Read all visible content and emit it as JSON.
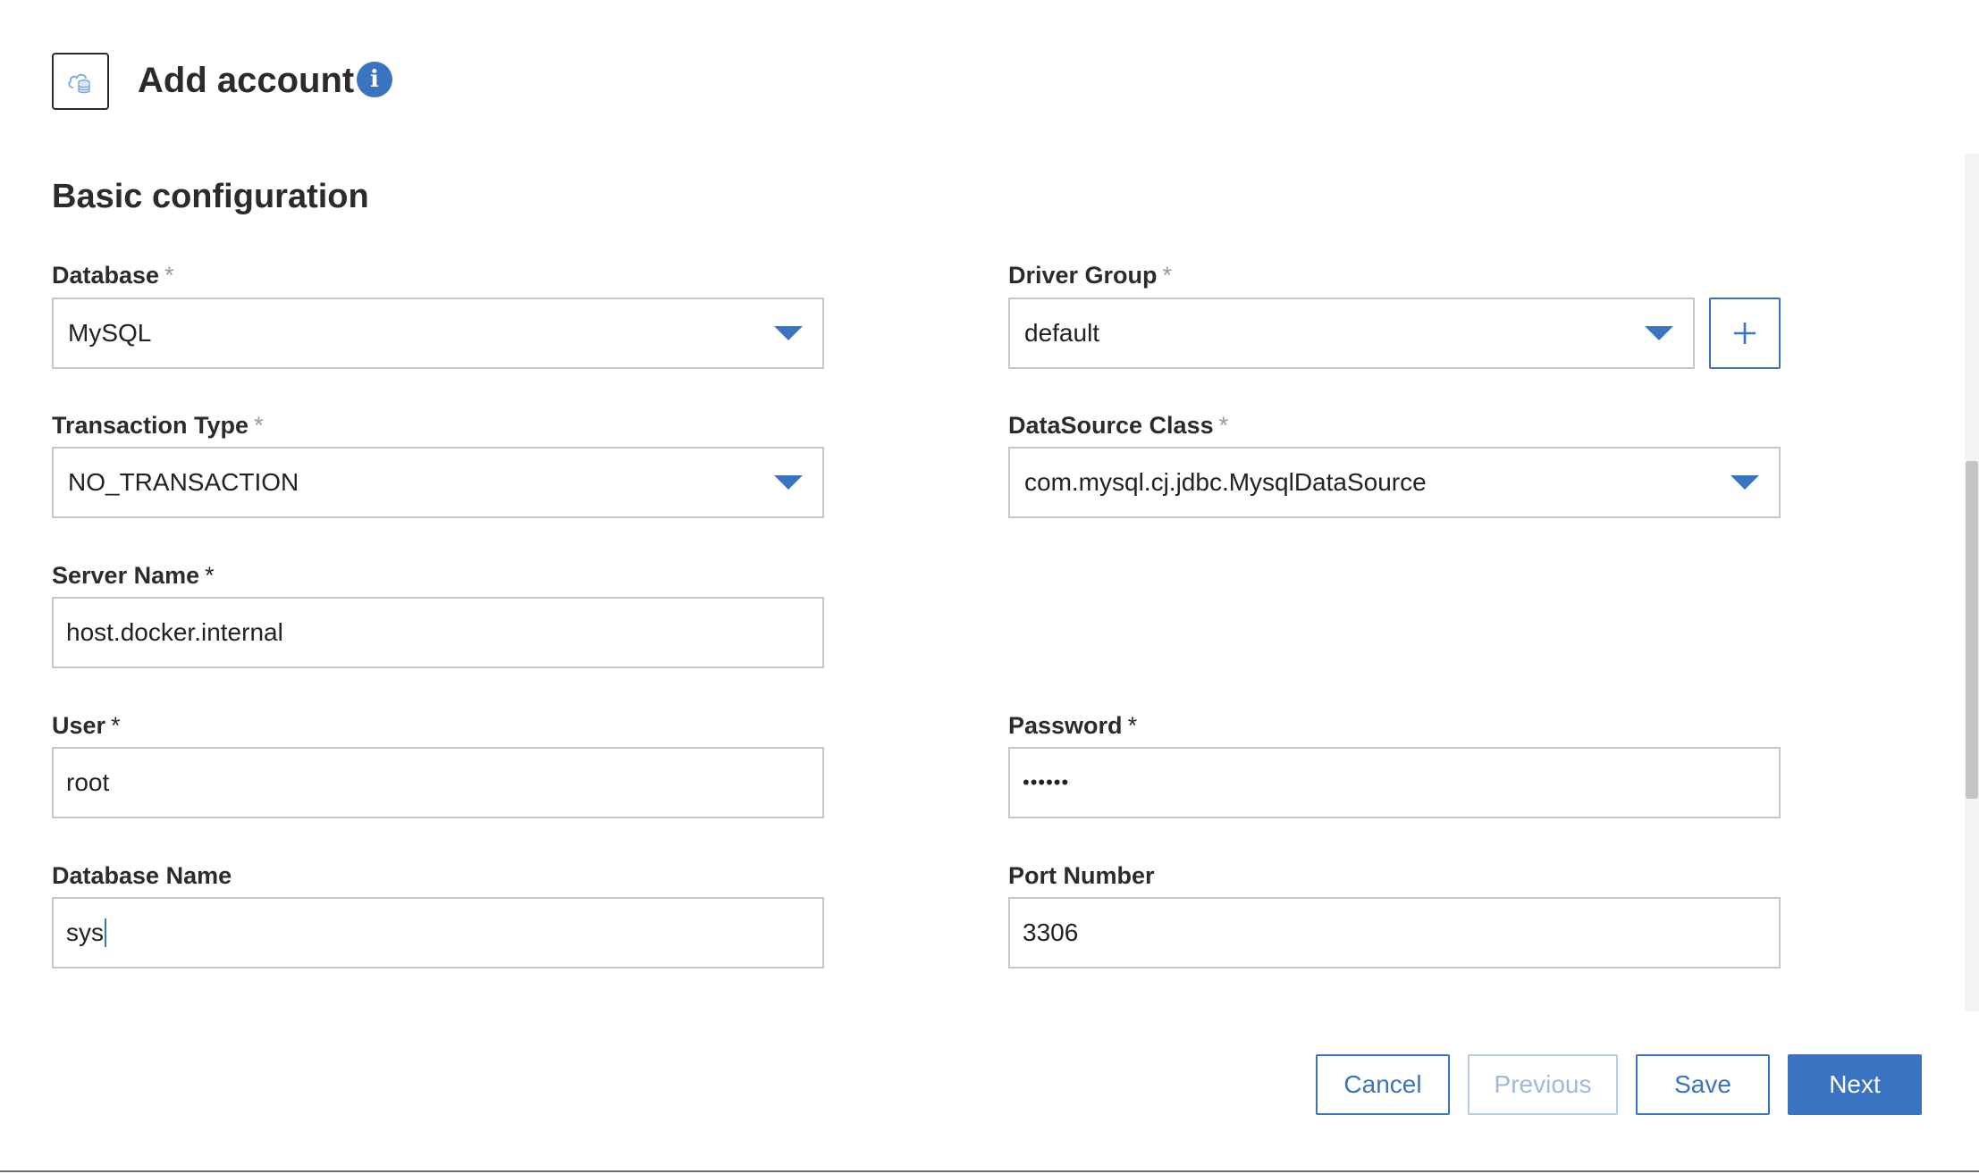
{
  "header": {
    "title": "Add account",
    "icon": "cloud-database-icon",
    "info_icon": "info-icon"
  },
  "section": {
    "title": "Basic configuration"
  },
  "fields": {
    "database": {
      "label": "Database",
      "required": "*",
      "value": "MySQL"
    },
    "driver_group": {
      "label": "Driver Group",
      "required": "*",
      "value": "default",
      "add_icon": "plus-icon"
    },
    "transaction_type": {
      "label": "Transaction Type",
      "required": "*",
      "value": "NO_TRANSACTION"
    },
    "datasource_class": {
      "label": "DataSource Class",
      "required": "*",
      "value": "com.mysql.cj.jdbc.MysqlDataSource"
    },
    "server_name": {
      "label": "Server Name",
      "required": "*",
      "value": "host.docker.internal"
    },
    "user": {
      "label": "User",
      "required": "*",
      "value": "root"
    },
    "password": {
      "label": "Password",
      "required": "*",
      "value": "••••••"
    },
    "database_name": {
      "label": "Database Name",
      "value": "sys"
    },
    "port_number": {
      "label": "Port Number",
      "value": "3306"
    }
  },
  "footer": {
    "cancel_label": "Cancel",
    "previous_label": "Previous",
    "save_label": "Save",
    "next_label": "Next"
  },
  "colors": {
    "accent": "#3a74c0",
    "border": "#c7c7c7",
    "text": "#2b2b2b"
  }
}
